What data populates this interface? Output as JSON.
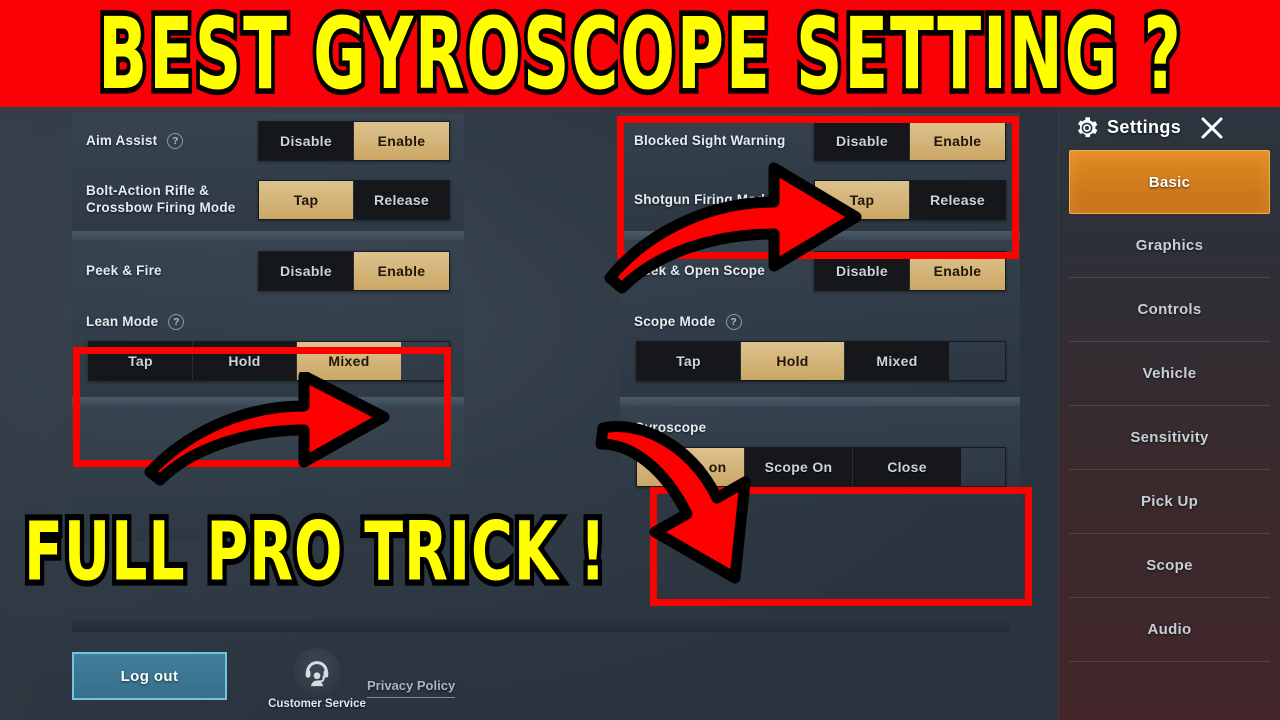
{
  "thumbnail": {
    "banner_text": "BEST  GYROSCOPE  SETTING ?",
    "lower_text": "FULL  PRO  TRICK !",
    "banner_bg": "#fb0007",
    "text_color": "#ffff00",
    "highlight_color": "#fe0000"
  },
  "sidebar": {
    "title": "Settings",
    "gear_icon": "gear-icon",
    "close_icon": "close-icon",
    "active_color": "#d87c1c",
    "items": [
      {
        "label": "Basic",
        "active": true
      },
      {
        "label": "Graphics",
        "active": false
      },
      {
        "label": "Controls",
        "active": false
      },
      {
        "label": "Vehicle",
        "active": false
      },
      {
        "label": "Sensitivity",
        "active": false
      },
      {
        "label": "Pick Up",
        "active": false
      },
      {
        "label": "Scope",
        "active": false
      },
      {
        "label": "Audio",
        "active": false
      }
    ]
  },
  "settings": {
    "accent_on": "#cba765",
    "left_column": [
      {
        "label": "Aim Assist",
        "help": "?",
        "layout": "inline",
        "options": [
          "Disable",
          "Enable"
        ],
        "selected": "Enable"
      },
      {
        "label": "Bolt-Action Rifle &\nCrossbow Firing Mode",
        "help": "",
        "layout": "inline",
        "options": [
          "Tap",
          "Release"
        ],
        "selected": "Tap"
      },
      {
        "label": "Peek & Fire",
        "help": "",
        "layout": "inline",
        "options": [
          "Disable",
          "Enable"
        ],
        "selected": "Enable"
      },
      {
        "label": "Lean Mode",
        "help": "?",
        "layout": "stacked",
        "options": [
          "Tap",
          "Hold",
          "Mixed"
        ],
        "selected": "Mixed"
      }
    ],
    "right_column": [
      {
        "label": "Blocked Sight Warning",
        "help": "",
        "layout": "inline",
        "options": [
          "Disable",
          "Enable"
        ],
        "selected": "Enable"
      },
      {
        "label": "Shotgun Firing Mode",
        "help": "",
        "layout": "inline",
        "options": [
          "Tap",
          "Release"
        ],
        "selected": "Tap"
      },
      {
        "label": "Peek & Open Scope",
        "help": "",
        "layout": "inline",
        "options": [
          "Disable",
          "Enable"
        ],
        "selected": "Enable"
      },
      {
        "label": "Scope Mode",
        "help": "?",
        "layout": "stacked",
        "options": [
          "Tap",
          "Hold",
          "Mixed"
        ],
        "selected": "Hold"
      },
      {
        "label": "Gyroscope",
        "help": "",
        "layout": "stacked",
        "options": [
          "Always on",
          "Scope On",
          "Close"
        ],
        "selected": "Always on"
      }
    ]
  },
  "footer": {
    "logout_label": "Log out",
    "customer_service_label": "Customer Service",
    "customer_service_icon": "headset-support-icon",
    "privacy_label": "Privacy Policy"
  }
}
